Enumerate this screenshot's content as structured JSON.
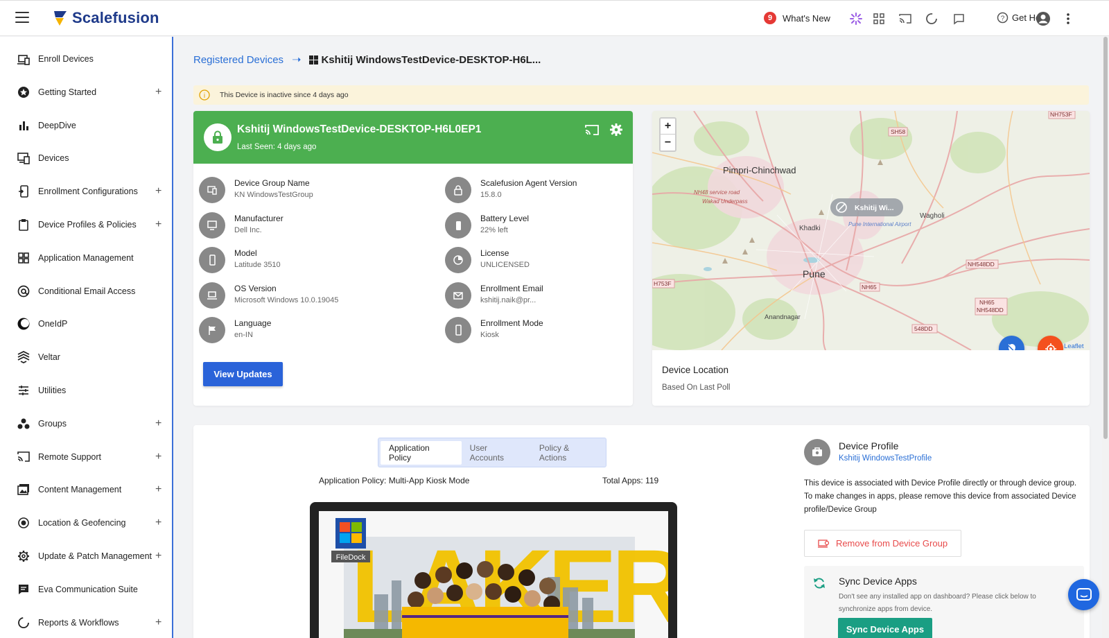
{
  "app": {
    "name": "Scalefusion"
  },
  "topbar": {
    "whats_new_count": "9",
    "whats_new_label": "What's New",
    "get_help_label": "Get Help"
  },
  "sidebar": {
    "items": [
      {
        "label": "Enroll Devices",
        "icon": "enroll-devices-icon",
        "plus": false
      },
      {
        "label": "Getting Started",
        "icon": "star-icon",
        "plus": true
      },
      {
        "label": "DeepDive",
        "icon": "bar-chart-icon",
        "plus": false
      },
      {
        "label": "Devices",
        "icon": "devices-icon",
        "plus": false
      },
      {
        "label": "Enrollment Configurations",
        "icon": "enrollment-config-icon",
        "plus": true
      },
      {
        "label": "Device Profiles & Policies",
        "icon": "clipboard-icon",
        "plus": true
      },
      {
        "label": "Application Management",
        "icon": "apps-grid-icon",
        "plus": false
      },
      {
        "label": "Conditional Email Access",
        "icon": "at-sign-icon",
        "plus": false
      },
      {
        "label": "OneIdP",
        "icon": "oneidp-icon",
        "plus": false
      },
      {
        "label": "Veltar",
        "icon": "veltar-icon",
        "plus": false
      },
      {
        "label": "Utilities",
        "icon": "sliders-icon",
        "plus": false
      },
      {
        "label": "Groups",
        "icon": "groups-icon",
        "plus": true
      },
      {
        "label": "Remote Support",
        "icon": "cast-icon",
        "plus": true
      },
      {
        "label": "Content Management",
        "icon": "photos-icon",
        "plus": true
      },
      {
        "label": "Location & Geofencing",
        "icon": "target-icon",
        "plus": true
      },
      {
        "label": "Update & Patch Management",
        "icon": "gear-icon",
        "plus": true
      },
      {
        "label": "Eva Communication Suite",
        "icon": "chat-icon",
        "plus": false
      },
      {
        "label": "Reports & Workflows",
        "icon": "reports-icon",
        "plus": true
      }
    ]
  },
  "breadcrumb": {
    "parent": "Registered Devices",
    "current": "Kshitij WindowsTestDevice-DESKTOP-H6L..."
  },
  "alert": {
    "text": "This Device is inactive since 4 days ago"
  },
  "device": {
    "name": "Kshitij WindowsTestDevice-DESKTOP-H6L0EP1",
    "last_seen": "Last Seen: 4 days ago",
    "left_info": [
      {
        "label": "Device Group Name",
        "value": "KN WindowsTestGroup",
        "icon": "device-group-icon"
      },
      {
        "label": "Manufacturer",
        "value": "Dell Inc.",
        "icon": "monitor-icon"
      },
      {
        "label": "Model",
        "value": "Latitude 3510",
        "icon": "phone-icon"
      },
      {
        "label": "OS Version",
        "value": "Microsoft Windows 10.0.19045",
        "icon": "laptop-icon"
      },
      {
        "label": "Language",
        "value": "en-IN",
        "icon": "flag-icon"
      }
    ],
    "right_info": [
      {
        "label": "Scalefusion Agent Version",
        "value": "15.8.0",
        "icon": "lock-icon"
      },
      {
        "label": "Battery Level",
        "value": "22% left",
        "icon": "battery-icon"
      },
      {
        "label": "License",
        "value": "UNLICENSED",
        "icon": "license-icon"
      },
      {
        "label": "Enrollment Email",
        "value": "kshitij.naik@pr...",
        "icon": "mail-icon"
      },
      {
        "label": "Enrollment Mode",
        "value": "Kiosk",
        "icon": "phone-icon"
      }
    ],
    "view_updates_label": "View Updates"
  },
  "map": {
    "title": "Device Location",
    "subtitle": "Based On Last Poll",
    "marker_label": "Kshitij Wi...",
    "attribution": "Leaflet",
    "zoom_in": "+",
    "zoom_out": "−",
    "places": {
      "pimpri": "Pimpri-Chinchwad",
      "pune": "Pune",
      "khadki": "Khadki",
      "wagholi": "Wagholi",
      "anandnagar": "Anandnagar",
      "airport": "Pune International Airport",
      "service_road": "NH48 service road",
      "underpass": "Wakad Underpass",
      "sh58": "SH58",
      "nh753f_top": "NH753F",
      "nh753f_left": "H753F",
      "nh548dd": "NH548DD",
      "nh65": "NH65",
      "nh65b": "NH65",
      "nh548dd_b": "NH548DD",
      "dd548": "548DD"
    }
  },
  "policy": {
    "tabs": [
      "Application Policy",
      "User Accounts",
      "Policy & Actions"
    ],
    "policy_label": "Application Policy: Multi-App Kiosk Mode",
    "total_apps": "Total Apps: 119",
    "desktop_icon_label": "FileDock"
  },
  "profile": {
    "title": "Device Profile",
    "link": "Kshitij WindowsTestProfile",
    "description": "This device is associated with Device Profile directly or through device group. To make changes in apps, please remove this device from associated Device profile/Device Group",
    "remove_label": "Remove from Device Group",
    "sync_title": "Sync Device Apps",
    "sync_desc": "Don't see any installed app on dashboard? Please click below to synchronize apps from device.",
    "sync_button": "Sync Device Apps"
  },
  "colors": {
    "brand": "#1e3a8a",
    "accent": "#2a63d9",
    "device_header": "#4caf50",
    "sync_button": "#1a9e83",
    "alert_bg": "#fbf3db"
  }
}
